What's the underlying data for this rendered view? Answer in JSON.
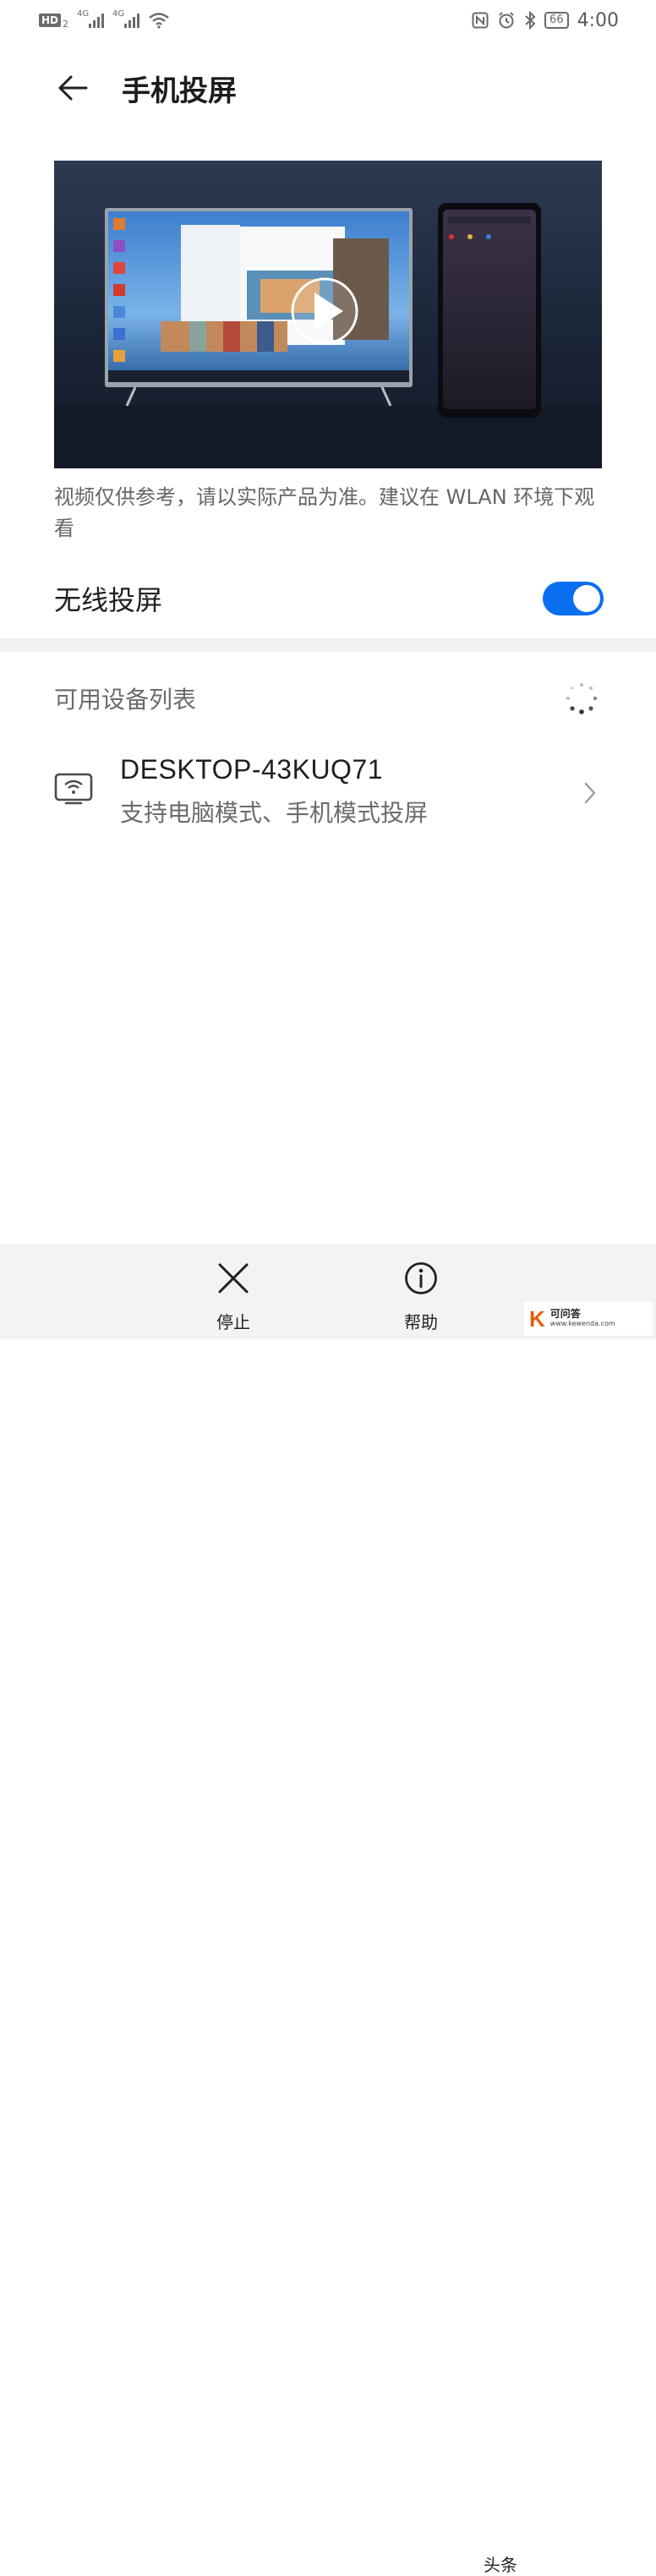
{
  "status_bar": {
    "hd_label": "HD",
    "hd_sub": "2",
    "network1": "4G",
    "network2": "4G",
    "battery": "66",
    "time": "4:00"
  },
  "header": {
    "title": "手机投屏"
  },
  "video": {
    "caption": "视频仅供参考，请以实际产品为准。建议在 WLAN 环境下观看"
  },
  "wireless": {
    "label": "无线投屏",
    "enabled": true
  },
  "devices": {
    "section_title": "可用设备列表",
    "items": [
      {
        "name": "DESKTOP-43KUQ71",
        "description": "支持电脑模式、手机模式投屏"
      }
    ]
  },
  "bottom_bar": {
    "stop_label": "停止",
    "help_label": "帮助",
    "partial_label": "头条"
  },
  "watermark": {
    "k": "K",
    "name": "可问答",
    "url": "www.kewenda.com"
  },
  "colors": {
    "accent": "#0a6ef0",
    "secondary_text": "#6b6b6b",
    "divider": "#f1f1f1"
  }
}
